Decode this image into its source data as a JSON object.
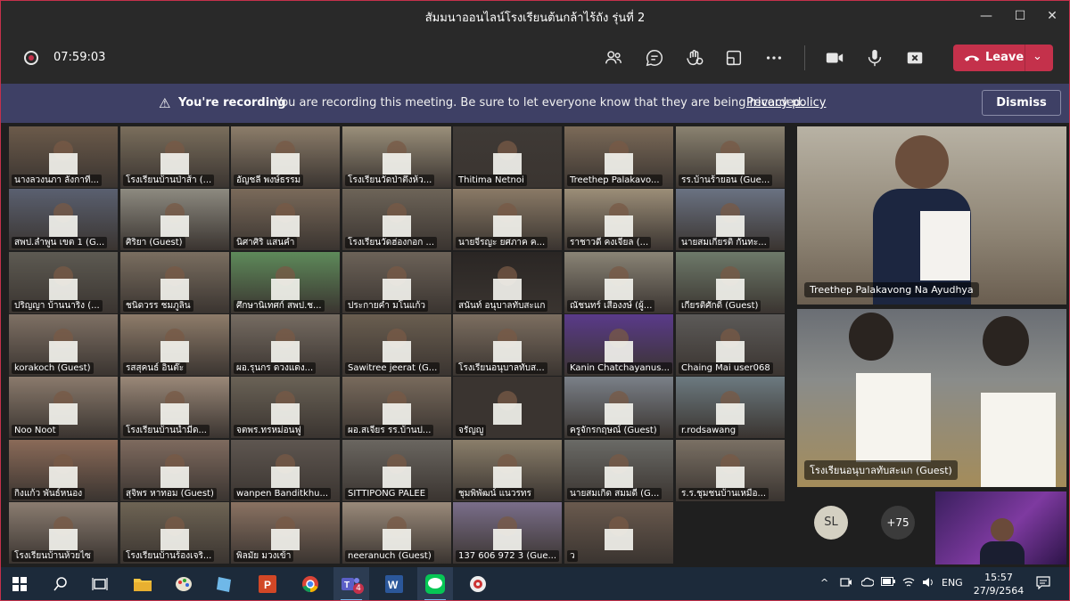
{
  "window": {
    "title": "สัมมนาออนไลน์โรงเรียนต้นกล้าไร้ถัง รุ่นที่ 2",
    "minimize_glyph": "—",
    "maximize_glyph": "☐",
    "close_glyph": "✕"
  },
  "toolbar": {
    "timer": "07:59:03",
    "leave_label": "Leave",
    "leave_chevron": "⌄",
    "icons": [
      "recording-indicator-icon",
      "people-icon",
      "chat-icon",
      "reactions-icon",
      "share-tray-icon",
      "more-icon",
      "camera-icon",
      "microphone-icon",
      "share-screen-icon",
      "phone-icon"
    ],
    "colors": {
      "leave": "#c4314b",
      "bar": "#292929"
    }
  },
  "banner": {
    "warning_glyph": "⚠",
    "heading": "You're recording",
    "message": "You are recording this meeting. Be sure to let everyone know that they are being recorded.",
    "link": "Privacy policy",
    "dismiss": "Dismiss",
    "color": "#3e4065"
  },
  "gallery": {
    "tiles": [
      {
        "name": "นางลวงนภา ลังกาที่...",
        "bg": "#6b5a4a"
      },
      {
        "name": "โรงเรียนบ้านป่าส้า (...",
        "bg": "#7a6e5c"
      },
      {
        "name": "อัญชลี พงษ์ธรรม",
        "bg": "#8c7d6a"
      },
      {
        "name": "โรงเรียนวัดป่าตึงห้ว...",
        "bg": "#9a8f7a"
      },
      {
        "name": "Thitima Netnoi",
        "bg": "#3f3a36"
      },
      {
        "name": "Treethep Palakavo...",
        "bg": "#7b6a58"
      },
      {
        "name": "รร.บ้านร้ายอน (Gue...",
        "bg": "#8a8270"
      },
      {
        "name": "สพป.ลำพูน เขต 1 (G...",
        "bg": "#5a6070"
      },
      {
        "name": "ศิริยา (Guest)",
        "bg": "#8d8a80"
      },
      {
        "name": "นิศาศิริ แสนคำ",
        "bg": "#7a6a5a"
      },
      {
        "name": "โรงเรียนวัดฮ่องกอก ...",
        "bg": "#6d6458"
      },
      {
        "name": "นายจีรญะ ยศภาค ค...",
        "bg": "#8a7a66"
      },
      {
        "name": "ราชาวดี คงเจียล (...",
        "bg": "#9c8e78"
      },
      {
        "name": "นายสมเกียรติ กันทะ...",
        "bg": "#6a7282"
      },
      {
        "name": "ปริญญา บ้านนาริง (...",
        "bg": "#5d5a52"
      },
      {
        "name": "ชนิดวรร ชมภูลิน",
        "bg": "#7a6e60"
      },
      {
        "name": "ศึกษานิเทศก์ สพป.ช...",
        "bg": "#5e8a5a"
      },
      {
        "name": "ประกายคำ มโนแก้ว",
        "bg": "#6c6258"
      },
      {
        "name": "สนันท์ อนุบาลทับสะแก",
        "bg": "#2a2624"
      },
      {
        "name": "ณัชนทร์ เสืองงษ์ (ผู้...",
        "bg": "#8a8476"
      },
      {
        "name": "เกียรติศักดิ์ (Guest)",
        "bg": "#6e7a6a"
      },
      {
        "name": "korakoch (Guest)",
        "bg": "#7e7064"
      },
      {
        "name": "รสสุคนธ์ อินต๊ะ",
        "bg": "#8e7c6a"
      },
      {
        "name": "ผอ.รุนกร ดวงแดง...",
        "bg": "#766c62"
      },
      {
        "name": "Sawitree jeerat (G...",
        "bg": "#6a5e50"
      },
      {
        "name": "โรงเรียนอนุบาลทับส...",
        "bg": "#7c6e60"
      },
      {
        "name": "Kanin Chatchayanus...",
        "bg": "#5a3a8a"
      },
      {
        "name": "Chaing Mai user068",
        "bg": "#5c5a58"
      },
      {
        "name": "Noo Noot",
        "bg": "#8a7a6c"
      },
      {
        "name": "โรงเรียนบ้านน้ำมีด...",
        "bg": "#9a8878"
      },
      {
        "name": "จตพร.ทรหม่อนฟู",
        "bg": "#6a6256"
      },
      {
        "name": "ผอ.สเจียร รร.บ้านป...",
        "bg": "#786a5c"
      },
      {
        "name": "จรัญญู",
        "bg": "#3a3430"
      },
      {
        "name": "ครูจักรกฤษณ์ (Guest)",
        "bg": "#7a8088"
      },
      {
        "name": "r.rodsawang",
        "bg": "#6c7a80"
      },
      {
        "name": "กิ่งแก้ว พันธ์หนอง",
        "bg": "#8a6a58"
      },
      {
        "name": "สุจิพร หาทอม (Guest)",
        "bg": "#7e6a5e"
      },
      {
        "name": "wanpen Banditkhu...",
        "bg": "#5e5650"
      },
      {
        "name": "SITTIPONG PALEE",
        "bg": "#6a6660"
      },
      {
        "name": "ชุมพิพัฒน์ แนวรทร",
        "bg": "#8a7e6a"
      },
      {
        "name": "นายสมเกิด สมมดี (G...",
        "bg": "#6a6a66"
      },
      {
        "name": "ร.ร.ชุมชนบ้านเหมือ...",
        "bg": "#7a7064"
      },
      {
        "name": "โรงเรียนบ้านห้วยไซ",
        "bg": "#8a7c70"
      },
      {
        "name": "โรงเรียนบ้านร้องเจริ...",
        "bg": "#6e6454"
      },
      {
        "name": "พิลมัย มวงเข้า",
        "bg": "#8a7262"
      },
      {
        "name": "neeranuch (Guest)",
        "bg": "#9a8a7a"
      },
      {
        "name": "137 606 972 3 (Gue...",
        "bg": "#7a6e8a"
      },
      {
        "name": "ว",
        "bg": "#6a5a4e"
      }
    ]
  },
  "stage": {
    "featured_1": "Treethep Palakavong Na Ayudhya",
    "featured_2": "โรงเรียนอนุบาลทับสะแก (Guest)",
    "avatar_initials": "SL",
    "overflow_count": "+75"
  },
  "taskbar": {
    "apps": [
      "windows-start-icon",
      "search-icon",
      "task-view-icon",
      "file-explorer-icon",
      "paint-icon",
      "notepad-icon",
      "powerpoint-icon",
      "chrome-icon",
      "teams-icon",
      "word-icon",
      "line-icon",
      "media-player-icon"
    ],
    "teams_badge": "4",
    "language": "ENG",
    "time": "15:57",
    "date": "27/9/2564"
  }
}
